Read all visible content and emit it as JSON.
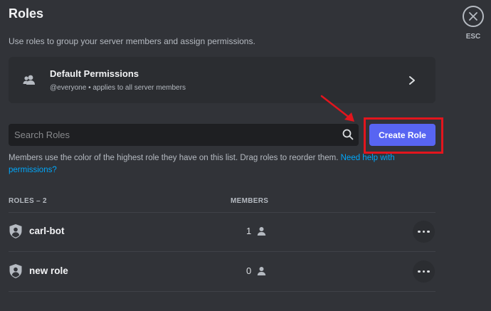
{
  "header": {
    "title": "Roles",
    "subtitle": "Use roles to group your server members and assign permissions.",
    "close_label": "ESC"
  },
  "default_permissions": {
    "title": "Default Permissions",
    "subtitle": "@everyone • applies to all server members"
  },
  "search": {
    "placeholder": "Search Roles",
    "value": ""
  },
  "create_button": {
    "label": "Create Role"
  },
  "help": {
    "text": "Members use the color of the highest role they have on this list. Drag roles to reorder them. ",
    "link": "Need help with permissions?"
  },
  "table": {
    "headers": {
      "roles": "ROLES – 2",
      "members": "MEMBERS"
    },
    "rows": [
      {
        "name": "carl-bot",
        "members": "1"
      },
      {
        "name": "new role",
        "members": "0"
      }
    ]
  },
  "annotation": {
    "highlight_color": "#e2151d",
    "arrow_color": "#e2151d"
  },
  "colors": {
    "background": "#313338",
    "panel": "#2b2d31",
    "accent": "#5865f2",
    "link": "#00a8fc"
  }
}
